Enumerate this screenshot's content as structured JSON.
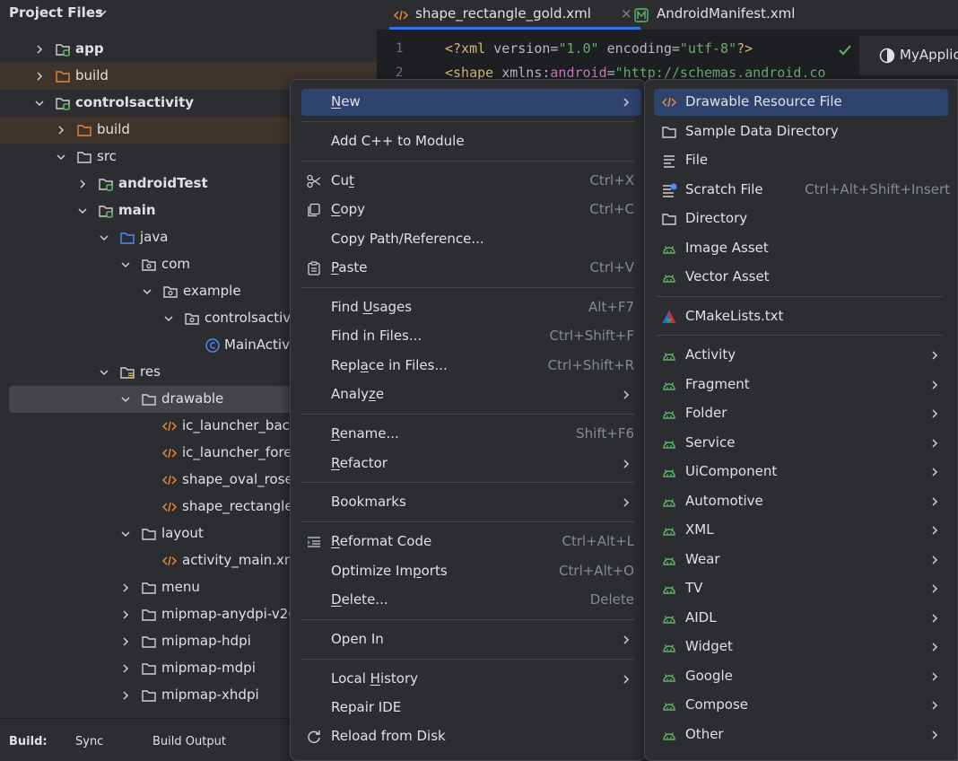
{
  "project_panel": {
    "title": "Project Files",
    "tree": [
      {
        "label": "app",
        "bold": true,
        "icon": "module-folder-icon",
        "chev": "right"
      },
      {
        "label": "build",
        "bold": false,
        "icon": "build-folder-icon",
        "chev": "right"
      },
      {
        "label": "controlsactivity",
        "bold": true,
        "icon": "module-folder-icon",
        "chev": "down"
      },
      {
        "label": "build",
        "bold": false,
        "icon": "build-folder-icon",
        "chev": "right"
      },
      {
        "label": "src",
        "bold": false,
        "icon": "folder-icon",
        "chev": "down"
      },
      {
        "label": "androidTest",
        "bold": true,
        "icon": "module-folder-icon",
        "chev": "right"
      },
      {
        "label": "main",
        "bold": true,
        "icon": "module-folder-icon",
        "chev": "down"
      },
      {
        "label": "java",
        "bold": false,
        "icon": "source-folder-icon",
        "chev": "down"
      },
      {
        "label": "com",
        "bold": false,
        "icon": "package-icon",
        "chev": "down"
      },
      {
        "label": "example",
        "bold": false,
        "icon": "package-icon",
        "chev": "down"
      },
      {
        "label": "controlsactivi",
        "bold": false,
        "icon": "package-icon",
        "chev": "down"
      },
      {
        "label": "MainActiv",
        "bold": false,
        "icon": "class-icon",
        "chev": ""
      },
      {
        "label": "res",
        "bold": false,
        "icon": "resource-folder-icon",
        "chev": "down"
      },
      {
        "label": "drawable",
        "bold": false,
        "icon": "folder-icon",
        "chev": "down"
      },
      {
        "label": "ic_launcher_back",
        "bold": false,
        "icon": "xml-file-icon",
        "chev": ""
      },
      {
        "label": "ic_launcher_fore",
        "bold": false,
        "icon": "xml-file-icon",
        "chev": ""
      },
      {
        "label": "shape_oval_rose",
        "bold": false,
        "icon": "xml-file-icon",
        "chev": ""
      },
      {
        "label": "shape_rectangle_",
        "bold": false,
        "icon": "xml-file-icon",
        "chev": ""
      },
      {
        "label": "layout",
        "bold": false,
        "icon": "folder-icon",
        "chev": "down"
      },
      {
        "label": "activity_main.xm",
        "bold": false,
        "icon": "xml-file-icon",
        "chev": ""
      },
      {
        "label": "menu",
        "bold": false,
        "icon": "folder-icon",
        "chev": "right"
      },
      {
        "label": "mipmap-anydpi-v26",
        "bold": false,
        "icon": "folder-icon",
        "chev": "right"
      },
      {
        "label": "mipmap-hdpi",
        "bold": false,
        "icon": "folder-icon",
        "chev": "right"
      },
      {
        "label": "mipmap-mdpi",
        "bold": false,
        "icon": "folder-icon",
        "chev": "right"
      },
      {
        "label": "mipmap-xhdpi",
        "bold": false,
        "icon": "folder-icon",
        "chev": "right"
      }
    ],
    "bottom": {
      "build": "Build:",
      "sync": "Sync",
      "output": "Build Output"
    }
  },
  "editor": {
    "tabs": [
      {
        "label": "shape_rectangle_gold.xml",
        "active": true,
        "close": "×"
      },
      {
        "label": "AndroidManifest.xml",
        "active": false
      }
    ],
    "lines": [
      "1",
      "2"
    ],
    "code": {
      "l1_open": "<?xml ",
      "l1_a1": "version=",
      "l1_v1": "\"1.0\"",
      "l1_a2": " encoding=",
      "l1_v2": "\"utf-8\"",
      "l1_close": "?>",
      "l2_open": "<shape ",
      "l2_ns": "xmlns:",
      "l2_attr": "android",
      "l2_eq": "=",
      "l2_val": "\"http://schemas.android.co"
    },
    "preview_label": "MyApplic"
  },
  "context_menu": {
    "new": {
      "pre": "",
      "u": "N",
      "post": "ew"
    },
    "add_cpp": "Add C++ to Module",
    "cut": {
      "pre": "Cu",
      "u": "t",
      "post": "",
      "shortcut": "Ctrl+X"
    },
    "copy": {
      "pre": "",
      "u": "C",
      "post": "opy",
      "shortcut": "Ctrl+C"
    },
    "copy_path": "Copy Path/Reference...",
    "paste": {
      "pre": "",
      "u": "P",
      "post": "aste",
      "shortcut": "Ctrl+V"
    },
    "find_usages": {
      "pre": "Find ",
      "u": "U",
      "post": "sages",
      "shortcut": "Alt+F7"
    },
    "find_in_files": {
      "label": "Find in Files...",
      "shortcut": "Ctrl+Shift+F"
    },
    "replace_in_files": {
      "pre": "Repl",
      "u": "a",
      "post": "ce in Files...",
      "shortcut": "Ctrl+Shift+R"
    },
    "analyze": {
      "pre": "Analy",
      "u": "z",
      "post": "e"
    },
    "rename": {
      "pre": "",
      "u": "R",
      "post": "ename...",
      "shortcut": "Shift+F6"
    },
    "refactor": {
      "pre": "",
      "u": "R",
      "post": "efactor"
    },
    "bookmarks": "Bookmarks",
    "reformat": {
      "pre": "",
      "u": "R",
      "post": "eformat Code",
      "shortcut": "Ctrl+Alt+L"
    },
    "optimize": {
      "pre": "Optimize Im",
      "u": "p",
      "post": "orts",
      "shortcut": "Ctrl+Alt+O"
    },
    "delete": {
      "pre": "",
      "u": "D",
      "post": "elete...",
      "shortcut": "Delete"
    },
    "open_in": "Open In",
    "local_history": {
      "pre": "Local ",
      "u": "H",
      "post": "istory"
    },
    "repair_ide": "Repair IDE",
    "reload": "Reload from Disk"
  },
  "new_submenu": [
    {
      "label": "Drawable Resource File",
      "icon": "xml-file-icon",
      "shortcut": "",
      "arrow": false,
      "active": true
    },
    {
      "label": "Sample Data Directory",
      "icon": "folder-icon",
      "shortcut": "",
      "arrow": false
    },
    {
      "label": "File",
      "icon": "text-file-icon",
      "shortcut": "",
      "arrow": false
    },
    {
      "label": "Scratch File",
      "icon": "scratch-file-icon",
      "shortcut": "Ctrl+Alt+Shift+Insert",
      "arrow": false
    },
    {
      "label": "Directory",
      "icon": "folder-icon",
      "shortcut": "",
      "arrow": false
    },
    {
      "label": "Image Asset",
      "icon": "android-icon",
      "shortcut": "",
      "arrow": false
    },
    {
      "label": "Vector Asset",
      "icon": "android-icon",
      "shortcut": "",
      "arrow": false
    },
    {
      "label": "CMakeLists.txt",
      "icon": "cmake-icon",
      "shortcut": "",
      "arrow": false
    },
    {
      "label": "Activity",
      "icon": "android-icon",
      "shortcut": "",
      "arrow": true
    },
    {
      "label": "Fragment",
      "icon": "android-icon",
      "shortcut": "",
      "arrow": true
    },
    {
      "label": "Folder",
      "icon": "android-icon",
      "shortcut": "",
      "arrow": true
    },
    {
      "label": "Service",
      "icon": "android-icon",
      "shortcut": "",
      "arrow": true
    },
    {
      "label": "UiComponent",
      "icon": "android-icon",
      "shortcut": "",
      "arrow": true
    },
    {
      "label": "Automotive",
      "icon": "android-icon",
      "shortcut": "",
      "arrow": true
    },
    {
      "label": "XML",
      "icon": "android-icon",
      "shortcut": "",
      "arrow": true
    },
    {
      "label": "Wear",
      "icon": "android-icon",
      "shortcut": "",
      "arrow": true
    },
    {
      "label": "TV",
      "icon": "android-icon",
      "shortcut": "",
      "arrow": true
    },
    {
      "label": "AIDL",
      "icon": "android-icon",
      "shortcut": "",
      "arrow": true
    },
    {
      "label": "Widget",
      "icon": "android-icon",
      "shortcut": "",
      "arrow": true
    },
    {
      "label": "Google",
      "icon": "android-icon",
      "shortcut": "",
      "arrow": true
    },
    {
      "label": "Compose",
      "icon": "android-icon",
      "shortcut": "",
      "arrow": true
    },
    {
      "label": "Other",
      "icon": "android-icon",
      "shortcut": "",
      "arrow": true
    }
  ],
  "colors": {
    "accent": "#3574f0",
    "selection": "#2e436e",
    "android_green": "#5fb865",
    "xml_orange": "#e0883f",
    "folder_gray": "#ced0d6"
  }
}
